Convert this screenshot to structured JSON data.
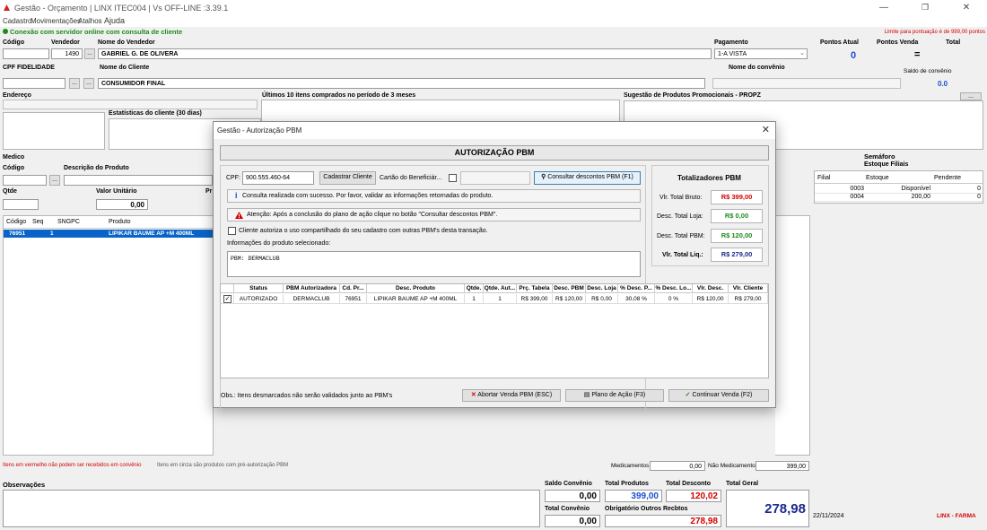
{
  "window": {
    "title": "Gestão - Orçamento  |  LINX ITEC004  |  Vs OFF-LINE :3.39.1"
  },
  "menu": [
    "Cadastro",
    "Movimentações",
    "Atalhos",
    "Ajuda"
  ],
  "status": {
    "connection": "Conexão com servidor online com consulta de cliente",
    "limit_note": "Limite para pontuação é de 999,00 pontos"
  },
  "header": {
    "codigo_label": "Código",
    "vendedor_label": "Vendedor",
    "vendedor_code": "1490",
    "nome_vendedor_label": "Nome do Vendedor",
    "nome_vendedor": "GABRIEL G. DE OLIVERA",
    "pagamento_label": "Pagamento",
    "pagamento": "1-A VISTA",
    "pontos_atual_label": "Pontos Atual",
    "pontos_atual": "0",
    "pontos_venda_label": "Pontos Venda",
    "pontos_venda": "=",
    "total_label": "Total",
    "cpf_label": "CPF FIDELIDADE",
    "nome_cliente_label": "Nome do Cliente",
    "nome_cliente": "CONSUMIDOR FINAL",
    "convenio_label": "Nome do convênio",
    "saldo_convenio_label": "Saldo de convênio",
    "saldo_convenio": "0.0",
    "endereco_label": "Endereço",
    "ultimos_label": "Últimos 10 itens comprados no período de 3 meses",
    "sugestao_label": "Sugestão de Produtos Promocionais - PROPZ",
    "estatisticas_label": "Estatísticas do cliente  (30 dias)",
    "medico_label": "Medico",
    "codigo2_label": "Código",
    "descricao_label": "Descrição do Produto",
    "qtde_label": "Qtde",
    "valor_unitario_label": "Valor Unitário",
    "valor_unitario": "0,00",
    "pr_label": "Pr",
    "semaforo_label": "Semáforo",
    "estoque_filiais_label": "Estoque Filiais",
    "dots": "..."
  },
  "items_table": {
    "headers": [
      "Código",
      "Seq",
      "SNGPC",
      "Produto"
    ],
    "rows": [
      [
        "76951",
        "1",
        "",
        "LIPIKAR BAUME AP +M 400ML"
      ]
    ]
  },
  "stock_table": {
    "headers": [
      "Filial",
      "Estoque",
      "Pendente"
    ],
    "rows": [
      [
        "0003",
        "Disponível",
        "0"
      ],
      [
        "0004",
        "200,00",
        "0"
      ]
    ]
  },
  "legends": {
    "red": "Itens em vermelho não podem ser recebidos em convênio",
    "gray": "Itens em cinza são produtos com pré-autorização PBM"
  },
  "medicamentos": {
    "label": "Medicamentos",
    "value": "0,00",
    "nao_label": "Não Medicamentos",
    "nao_value": "399,00"
  },
  "observacoes_label": "Observações",
  "totals": {
    "saldo_convenio_label": "Saldo Convênio",
    "saldo_convenio": "0,00",
    "total_produtos_label": "Total Produtos",
    "total_produtos": "399,00",
    "total_desconto_label": "Total Desconto",
    "total_desconto": "120,02",
    "total_geral_label": "Total Geral",
    "total_geral": "278,98",
    "total_convenio_label": "Total Convênio",
    "total_convenio": "0,00",
    "obrigatorio_label": "Obrigatório Outros Recbtos",
    "obrigatorio": "278,98",
    "date": "22/11/2024",
    "brand": "LINX - FARMA"
  },
  "colors": {
    "green": "#1a8c1a",
    "red": "#d40000",
    "blue": "#1f4fd1",
    "navy": "#1b2a8c",
    "selection": "#0a64c8"
  },
  "dialog": {
    "title": "Gestão - Autorização PBM",
    "heading": "AUTORIZAÇÃO PBM",
    "cpf_label": "CPF:",
    "cpf_value": "900.555.460-64",
    "cadastrar_button": "Cadastrar Cliente",
    "cartao_label": "Cartão do Beneficiár...",
    "consultar_button": "Consultar descontos PBM (F1)",
    "info_msg": "Consulta realizada com sucesso. Por favor, validar as informações retornadas do produto.",
    "warn_msg": "Atenção: Após a conclusão do plano de ação clique no botão \"Consultar descontos PBM\".",
    "consent_label": "Cliente autoriza o uso compartilhado do seu cadastro com outras PBM's desta transação.",
    "info_produto_label": "Informações do produto selecionado:",
    "info_produto_value": "PBM: DERMACLUB",
    "grid_headers": [
      "Status",
      "PBM Autorizadora",
      "Cd. Pr...",
      "Desc. Produto",
      "Qtde.",
      "Qtde. Aut...",
      "Prç. Tabela",
      "Desc. PBM",
      "Desc. Loja",
      "% Desc. P...",
      "% Desc. Lo...",
      "Vlr. Desc.",
      "Vlr. Cliente"
    ],
    "grid_rows": [
      [
        "AUTORIZADO",
        "DERMACLUB",
        "76951",
        "LIPIKAR BAUME AP +M 400ML",
        "1",
        "1",
        "R$ 399,00",
        "R$ 120,00",
        "R$ 0,00",
        "30,08 %",
        "0 %",
        "R$ 120,00",
        "R$ 279,00"
      ]
    ],
    "totalizadores_label": "Totalizadores PBM",
    "vlr_total_bruto_label": "Vlr. Total Bruto:",
    "vlr_total_bruto": "R$ 399,00",
    "desc_total_loja_label": "Desc. Total Loja:",
    "desc_total_loja": "R$ 0,00",
    "desc_total_pbm_label": "Desc. Total PBM:",
    "desc_total_pbm": "R$ 120,00",
    "vlr_total_liq_label": "Vlr. Total Liq.:",
    "vlr_total_liq": "R$ 279,00",
    "obs": "Obs.: Itens desmarcados não serão validados junto ao PBM's",
    "abortar_button": "Abortar Venda PBM (ESC)",
    "plano_button": "Plano de Ação (F3)",
    "continuar_button": "Continuar Venda (F2)"
  }
}
